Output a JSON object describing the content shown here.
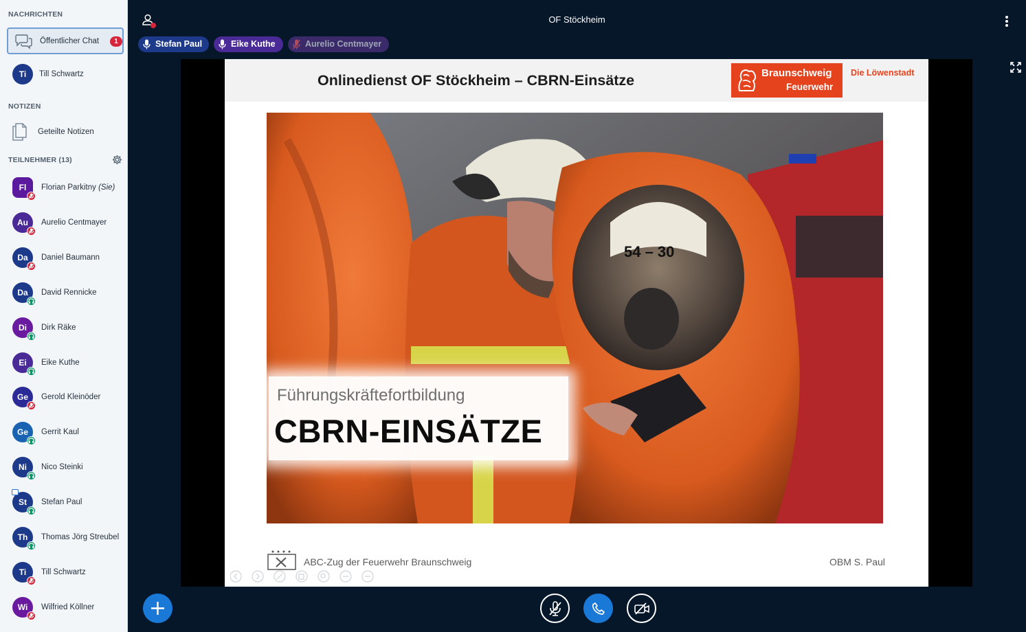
{
  "sidebar": {
    "messages_title": "NACHRICHTEN",
    "public_chat": {
      "label": "Öffentlicher Chat",
      "unread": "1"
    },
    "private_chat": {
      "initials": "Ti",
      "name": "Till Schwartz",
      "color": "#1d3a8a"
    },
    "notes_title": "NOTIZEN",
    "shared_notes": "Geteilte Notizen",
    "participants_title": "TEILNEHMER (13)",
    "participants": [
      {
        "initials": "Fl",
        "name": "Florian Parkitny",
        "you": "(Sie)",
        "color": "#5b1a9e",
        "shape": "square",
        "status": "muted"
      },
      {
        "initials": "Au",
        "name": "Aurelio Centmayer",
        "color": "#4a2a96",
        "shape": "round",
        "status": "muted"
      },
      {
        "initials": "Da",
        "name": "Daniel Baumann",
        "color": "#1d3a8a",
        "shape": "round",
        "status": "muted"
      },
      {
        "initials": "Da",
        "name": "David Rennicke",
        "color": "#1d3a8a",
        "shape": "round",
        "status": "listen"
      },
      {
        "initials": "Di",
        "name": "Dirk Räke",
        "color": "#6a1a9e",
        "shape": "round",
        "status": "listen"
      },
      {
        "initials": "Ei",
        "name": "Eike Kuthe",
        "color": "#4a2a96",
        "shape": "round",
        "status": "listen"
      },
      {
        "initials": "Ge",
        "name": "Gerold Kleinöder",
        "color": "#2b2a96",
        "shape": "round",
        "status": "muted"
      },
      {
        "initials": "Ge",
        "name": "Gerrit Kaul",
        "color": "#1a63b3",
        "shape": "round",
        "status": "listen"
      },
      {
        "initials": "Ni",
        "name": "Nico Steinki",
        "color": "#1d3a8a",
        "shape": "round",
        "status": "listen"
      },
      {
        "initials": "St",
        "name": "Stefan Paul",
        "color": "#1d3a8a",
        "shape": "round",
        "status": "listen",
        "presenter": true
      },
      {
        "initials": "Th",
        "name": "Thomas Jörg Streubel",
        "color": "#1d3a8a",
        "shape": "round",
        "status": "listen"
      },
      {
        "initials": "Ti",
        "name": "Till Schwartz",
        "color": "#1d3a8a",
        "shape": "round",
        "status": "muted"
      },
      {
        "initials": "Wi",
        "name": "Wilfried Köllner",
        "color": "#6a1a9e",
        "shape": "round",
        "status": "muted"
      }
    ]
  },
  "header": {
    "meeting_title": "OF Stöckheim",
    "talkers": [
      {
        "name": "Stefan Paul",
        "color": "#1d3a8a",
        "state": "talking"
      },
      {
        "name": "Eike Kuthe",
        "color": "#4a2a96",
        "state": "talking"
      },
      {
        "name": "Aurelio Centmayer",
        "color": "#3a2a6a",
        "state": "muted"
      }
    ]
  },
  "slide": {
    "title": "Onlinedienst OF Stöckheim – CBRN-Einsätze",
    "logo_line1": "Braunschweig",
    "logo_line2": "Feuerwehr",
    "logo_tagline": "Die Löwenstadt",
    "caption_sub": "Führungskräftefortbildung",
    "caption_main": "CBRN-EINSÄTZE",
    "helmet_number": "54 – 30",
    "footer_left": "ABC-Zug der Feuerwehr Braunschweig",
    "footer_right": "OBM S. Paul"
  },
  "colors": {
    "accent": "#1a78d6",
    "muted": "#d6263b",
    "listen": "#0d9467",
    "brand_orange": "#e4431d"
  }
}
